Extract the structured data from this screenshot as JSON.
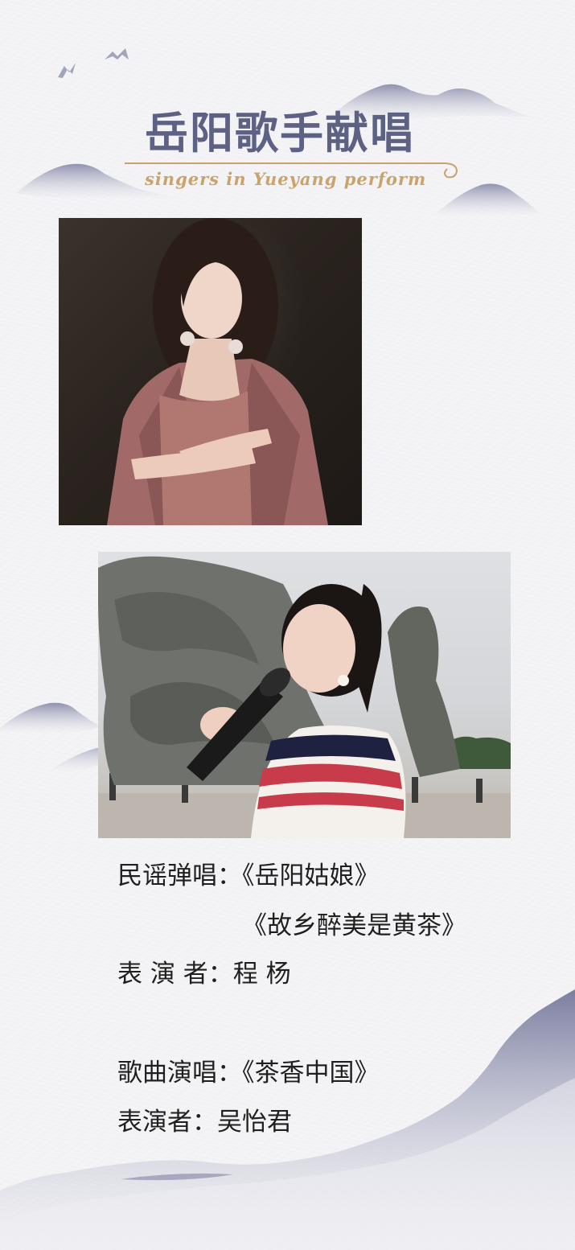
{
  "header": {
    "title": "岳阳歌手献唱",
    "subtitle": "singers in Yueyang perform"
  },
  "photos": [
    {
      "subject": "female singer portrait, pink velvet dress and blazer, dark background"
    },
    {
      "subject": "singer with microphone in striped top in front of stone sculpture"
    }
  ],
  "performances": [
    {
      "label": "民谣弹唱：",
      "songs": [
        "《岳阳姑娘》",
        "《故乡醉美是黄茶》"
      ],
      "performer_label": "表 演 者：",
      "performer": "程 杨"
    },
    {
      "label": "歌曲演唱：",
      "songs": [
        "《茶香中国》"
      ],
      "performer_label": "表演者：",
      "performer": "吴怡君"
    }
  ],
  "colors": {
    "title": "#5d6184",
    "subtitle": "#c9a36b",
    "ink": "#8f92ad",
    "text": "#1f1f1f"
  }
}
